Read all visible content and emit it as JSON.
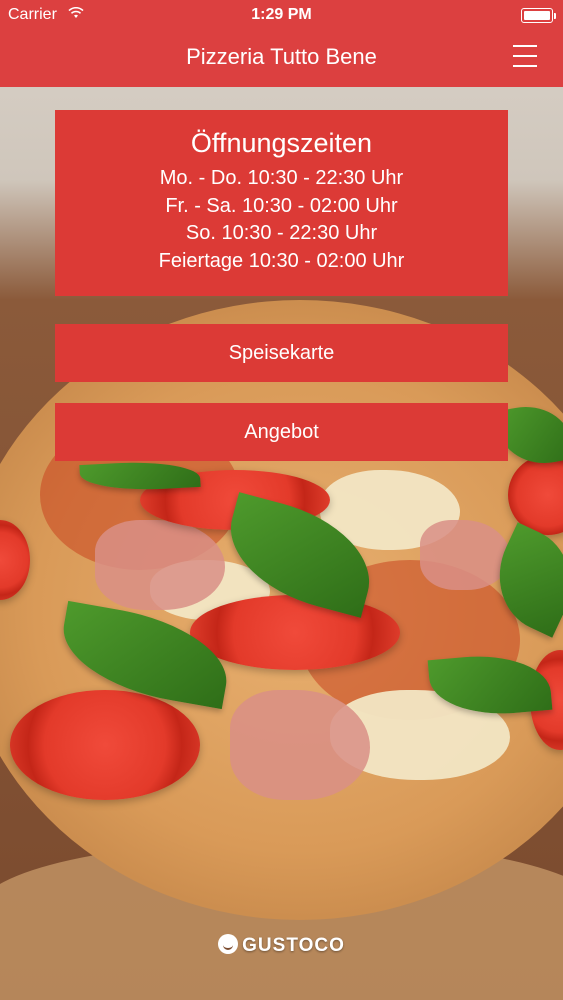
{
  "status_bar": {
    "carrier": "Carrier",
    "wifi_icon": "wifi-icon",
    "time": "1:29 PM",
    "battery_icon": "battery-icon"
  },
  "nav": {
    "title": "Pizzeria Tutto Bene",
    "menu_icon": "hamburger-menu-icon"
  },
  "hours": {
    "title": "Öffnungszeiten",
    "lines": [
      "Mo. - Do. 10:30 - 22:30 Uhr",
      "Fr. - Sa. 10:30 - 02:00 Uhr",
      "So. 10:30 - 22:30 Uhr",
      "Feiertage 10:30 - 02:00 Uhr"
    ]
  },
  "buttons": {
    "menu_label": "Speisekarte",
    "offer_label": "Angebot"
  },
  "footer": {
    "brand": "GUSTOCO",
    "logo_icon": "gustoco-logo-icon"
  },
  "colors": {
    "primary": "#dc4040",
    "card": "#dc3a36",
    "text": "#ffffff"
  }
}
